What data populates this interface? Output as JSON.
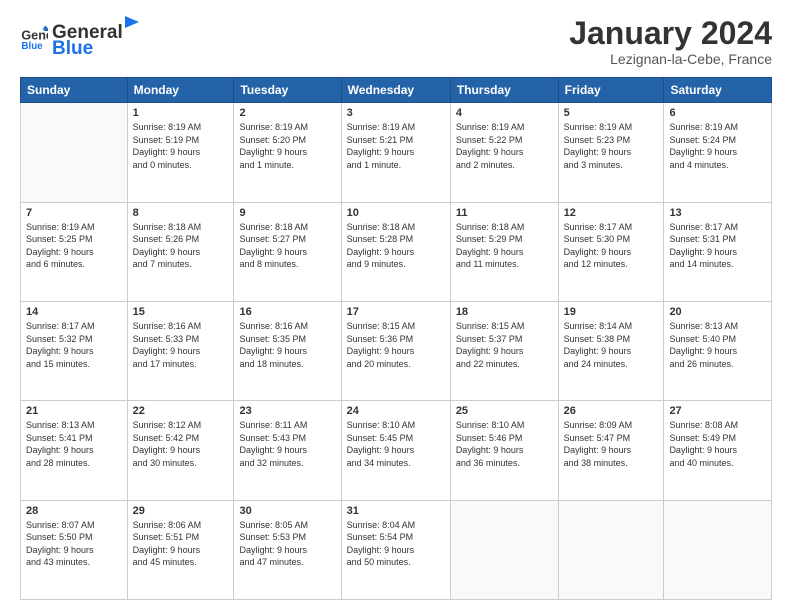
{
  "header": {
    "logo": {
      "general": "General",
      "blue": "Blue"
    },
    "title": "January 2024",
    "location": "Lezignan-la-Cebe, France"
  },
  "days_of_week": [
    "Sunday",
    "Monday",
    "Tuesday",
    "Wednesday",
    "Thursday",
    "Friday",
    "Saturday"
  ],
  "weeks": [
    [
      null,
      {
        "day": 1,
        "sunrise": "8:19 AM",
        "sunset": "5:19 PM",
        "daylight": "9 hours and 0 minutes."
      },
      {
        "day": 2,
        "sunrise": "8:19 AM",
        "sunset": "5:20 PM",
        "daylight": "9 hours and 1 minute."
      },
      {
        "day": 3,
        "sunrise": "8:19 AM",
        "sunset": "5:21 PM",
        "daylight": "9 hours and 1 minute."
      },
      {
        "day": 4,
        "sunrise": "8:19 AM",
        "sunset": "5:22 PM",
        "daylight": "9 hours and 2 minutes."
      },
      {
        "day": 5,
        "sunrise": "8:19 AM",
        "sunset": "5:23 PM",
        "daylight": "9 hours and 3 minutes."
      },
      {
        "day": 6,
        "sunrise": "8:19 AM",
        "sunset": "5:24 PM",
        "daylight": "9 hours and 4 minutes."
      }
    ],
    [
      {
        "day": 7,
        "sunrise": "8:19 AM",
        "sunset": "5:25 PM",
        "daylight": "9 hours and 6 minutes."
      },
      {
        "day": 8,
        "sunrise": "8:18 AM",
        "sunset": "5:26 PM",
        "daylight": "9 hours and 7 minutes."
      },
      {
        "day": 9,
        "sunrise": "8:18 AM",
        "sunset": "5:27 PM",
        "daylight": "9 hours and 8 minutes."
      },
      {
        "day": 10,
        "sunrise": "8:18 AM",
        "sunset": "5:28 PM",
        "daylight": "9 hours and 9 minutes."
      },
      {
        "day": 11,
        "sunrise": "8:18 AM",
        "sunset": "5:29 PM",
        "daylight": "9 hours and 11 minutes."
      },
      {
        "day": 12,
        "sunrise": "8:17 AM",
        "sunset": "5:30 PM",
        "daylight": "9 hours and 12 minutes."
      },
      {
        "day": 13,
        "sunrise": "8:17 AM",
        "sunset": "5:31 PM",
        "daylight": "9 hours and 14 minutes."
      }
    ],
    [
      {
        "day": 14,
        "sunrise": "8:17 AM",
        "sunset": "5:32 PM",
        "daylight": "9 hours and 15 minutes."
      },
      {
        "day": 15,
        "sunrise": "8:16 AM",
        "sunset": "5:33 PM",
        "daylight": "9 hours and 17 minutes."
      },
      {
        "day": 16,
        "sunrise": "8:16 AM",
        "sunset": "5:35 PM",
        "daylight": "9 hours and 18 minutes."
      },
      {
        "day": 17,
        "sunrise": "8:15 AM",
        "sunset": "5:36 PM",
        "daylight": "9 hours and 20 minutes."
      },
      {
        "day": 18,
        "sunrise": "8:15 AM",
        "sunset": "5:37 PM",
        "daylight": "9 hours and 22 minutes."
      },
      {
        "day": 19,
        "sunrise": "8:14 AM",
        "sunset": "5:38 PM",
        "daylight": "9 hours and 24 minutes."
      },
      {
        "day": 20,
        "sunrise": "8:13 AM",
        "sunset": "5:40 PM",
        "daylight": "9 hours and 26 minutes."
      }
    ],
    [
      {
        "day": 21,
        "sunrise": "8:13 AM",
        "sunset": "5:41 PM",
        "daylight": "9 hours and 28 minutes."
      },
      {
        "day": 22,
        "sunrise": "8:12 AM",
        "sunset": "5:42 PM",
        "daylight": "9 hours and 30 minutes."
      },
      {
        "day": 23,
        "sunrise": "8:11 AM",
        "sunset": "5:43 PM",
        "daylight": "9 hours and 32 minutes."
      },
      {
        "day": 24,
        "sunrise": "8:10 AM",
        "sunset": "5:45 PM",
        "daylight": "9 hours and 34 minutes."
      },
      {
        "day": 25,
        "sunrise": "8:10 AM",
        "sunset": "5:46 PM",
        "daylight": "9 hours and 36 minutes."
      },
      {
        "day": 26,
        "sunrise": "8:09 AM",
        "sunset": "5:47 PM",
        "daylight": "9 hours and 38 minutes."
      },
      {
        "day": 27,
        "sunrise": "8:08 AM",
        "sunset": "5:49 PM",
        "daylight": "9 hours and 40 minutes."
      }
    ],
    [
      {
        "day": 28,
        "sunrise": "8:07 AM",
        "sunset": "5:50 PM",
        "daylight": "9 hours and 43 minutes."
      },
      {
        "day": 29,
        "sunrise": "8:06 AM",
        "sunset": "5:51 PM",
        "daylight": "9 hours and 45 minutes."
      },
      {
        "day": 30,
        "sunrise": "8:05 AM",
        "sunset": "5:53 PM",
        "daylight": "9 hours and 47 minutes."
      },
      {
        "day": 31,
        "sunrise": "8:04 AM",
        "sunset": "5:54 PM",
        "daylight": "9 hours and 50 minutes."
      },
      null,
      null,
      null
    ]
  ]
}
